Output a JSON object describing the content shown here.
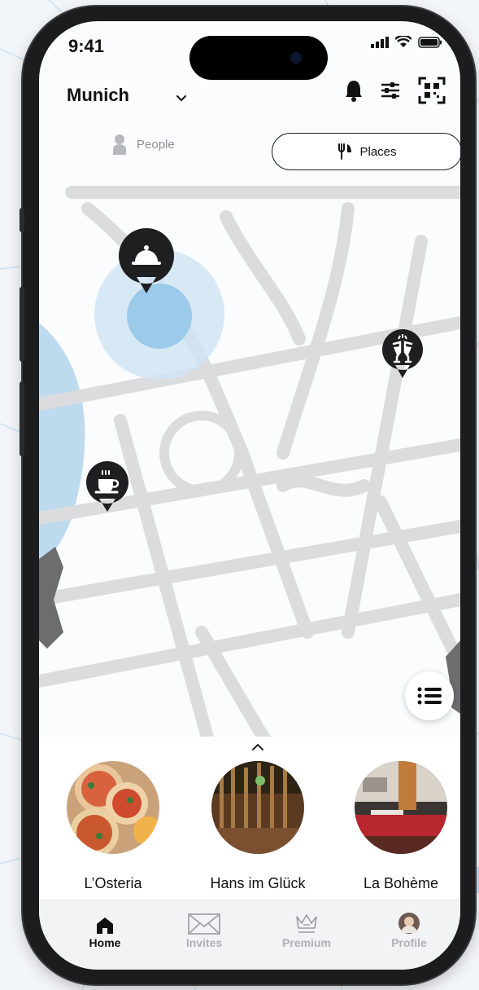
{
  "status_bar": {
    "time": "9:41"
  },
  "header": {
    "city": "Munich"
  },
  "toggle": {
    "people_label": "People",
    "places_label": "Places"
  },
  "places": [
    {
      "name": "L’Osteria"
    },
    {
      "name": "Hans im Glück"
    },
    {
      "name": "La Bohème"
    }
  ],
  "tabs": [
    {
      "label": "Home",
      "active": true
    },
    {
      "label": "Invites",
      "active": false
    },
    {
      "label": "Premium",
      "active": false
    },
    {
      "label": "Profile",
      "active": false
    }
  ],
  "colors": {
    "accent": "#1c1c1e",
    "map_water": "#a9cfe8",
    "map_road": "#d6d6d8"
  }
}
